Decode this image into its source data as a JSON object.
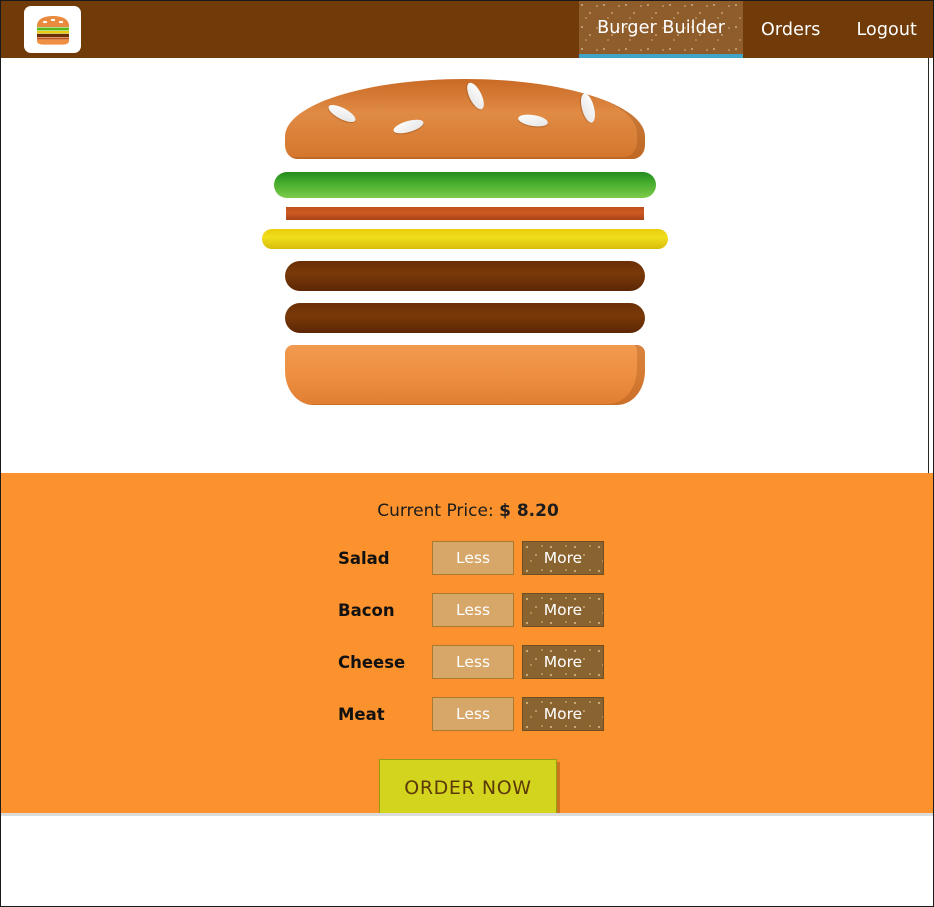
{
  "toolbar": {
    "logo_icon": "burger-logo-icon",
    "nav_items": [
      {
        "label": "Burger Builder",
        "active": true
      },
      {
        "label": "Orders",
        "active": false
      },
      {
        "label": "Logout",
        "active": false
      }
    ],
    "background_color": "#703B09",
    "active_tab_bg": "#8F5C2C",
    "active_tab_underline_color": "#40A4C8"
  },
  "burger": {
    "layers": [
      {
        "name": "bread-top",
        "color": "#D4762C",
        "seeds": 5
      },
      {
        "name": "salad",
        "color": "#3FA82A"
      },
      {
        "name": "bacon",
        "color": "#CE5B22"
      },
      {
        "name": "cheese",
        "color": "#F0DE1C"
      },
      {
        "name": "meat",
        "color": "#7A3908"
      },
      {
        "name": "meat",
        "color": "#7A3908"
      },
      {
        "name": "bread-bottom",
        "color": "#EE8F41"
      }
    ]
  },
  "controls": {
    "panel_color": "#FB922E",
    "price_label": "Current Price:",
    "price_value": "$ 8.20",
    "less_label": "Less",
    "more_label": "More",
    "ingredients": [
      {
        "label": "Salad"
      },
      {
        "label": "Bacon"
      },
      {
        "label": "Cheese"
      },
      {
        "label": "Meat"
      }
    ],
    "order_button_label": "ORDER NOW",
    "order_button_color": "#D3D41E"
  }
}
